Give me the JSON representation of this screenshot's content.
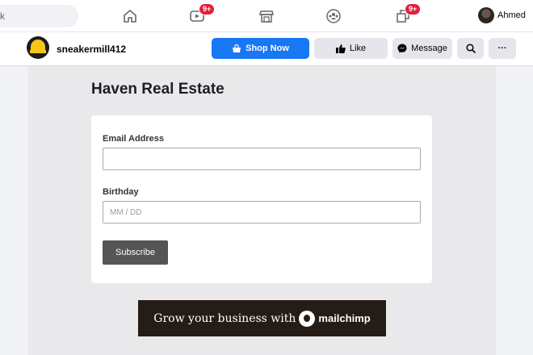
{
  "topnav": {
    "search_text": "k",
    "video_badge": "9+",
    "pages_badge": "9+",
    "profile_name": "Ahmed"
  },
  "pagebar": {
    "page_name": "sneakermill412",
    "shop_label": "Shop Now",
    "like_label": "Like",
    "message_label": "Message",
    "more_label": "···"
  },
  "form": {
    "title": "Haven Real Estate",
    "email_label": "Email Address",
    "email_value": "",
    "birthday_label": "Birthday",
    "birthday_placeholder": "MM / DD",
    "subscribe_label": "Subscribe"
  },
  "banner": {
    "text": "Grow your business with",
    "brand": "mailchimp"
  },
  "colors": {
    "primary": "#1877f2",
    "badge": "#e41e3f",
    "subscribe_bg": "#555555",
    "banner_bg": "#241c15"
  }
}
